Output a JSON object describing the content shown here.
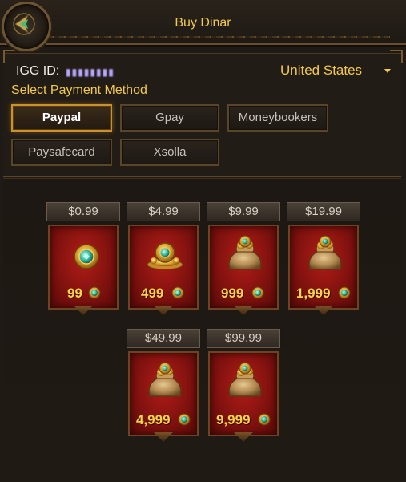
{
  "header": {
    "title": "Buy Dinar"
  },
  "account": {
    "igg_label": "IGG ID:",
    "igg_value": "▮▮▮▮▮▮▮▮",
    "country": "United States"
  },
  "payment": {
    "select_label": "Select Payment Method",
    "methods": [
      {
        "label": "Paypal",
        "active": true
      },
      {
        "label": "Gpay",
        "active": false
      },
      {
        "label": "Moneybookers",
        "active": false
      },
      {
        "label": "Paysafecard",
        "active": false
      },
      {
        "label": "Xsolla",
        "active": false
      }
    ]
  },
  "packages": [
    {
      "price": "$0.99",
      "amount": "99",
      "icon": "coin-icon"
    },
    {
      "price": "$4.99",
      "amount": "499",
      "icon": "coin-pile-icon"
    },
    {
      "price": "$9.99",
      "amount": "999",
      "icon": "coin-bag-icon"
    },
    {
      "price": "$19.99",
      "amount": "1,999",
      "icon": "coin-bag-icon"
    },
    {
      "price": "$49.99",
      "amount": "4,999",
      "icon": "coin-bag-icon"
    },
    {
      "price": "$99.99",
      "amount": "9,999",
      "icon": "coin-bag-icon"
    }
  ],
  "colors": {
    "accent_gold": "#f2c94c",
    "active_border": "#c9922e",
    "card_red": "#8a1410",
    "background": "#1f1a15"
  }
}
